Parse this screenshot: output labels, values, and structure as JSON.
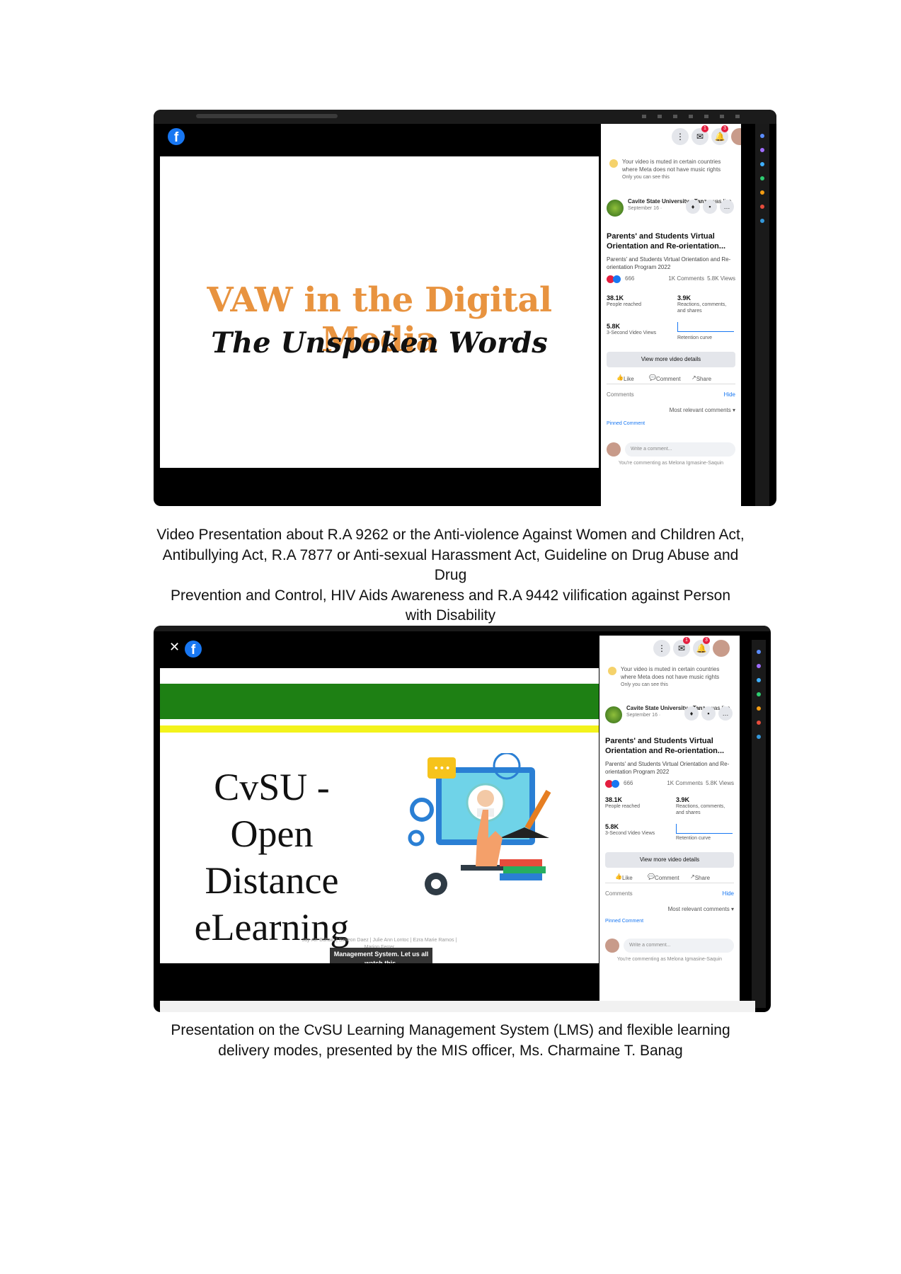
{
  "shot1": {
    "slide_title": "VAW in the Digital Media",
    "slide_subtitle": "The Unspoken Words"
  },
  "shot2": {
    "slide_lines": [
      "CvSU -",
      "Open Distance",
      "eLearning"
    ],
    "credits": "Jay-Arr Buhain | Simeon Daez | Julie Ann Lontoc | Ezra Marie Ramos | Marion Ferrer",
    "caption_overlay": "Management System. Let us all watch this."
  },
  "panel": {
    "muted_notice": "Your video is muted in certain countries where Meta does not have music rights",
    "only_you": "Only you can see this",
    "page_name": "Cavite State University - Tanza",
    "was_live": "was live.",
    "date": "September 16 ·",
    "video_title": "Parents' and Students Virtual Orientation and Re-orientation...",
    "video_desc": "Parents' and Students Virtual Orientation and Re-orientation Program 2022",
    "reactions_count": "666",
    "comments_count": "1K Comments",
    "views_count": "5.8K Views",
    "people_reached_num": "38.1K",
    "people_reached_label": "People reached",
    "reactions_num": "3.9K",
    "reactions_label": "Reactions, comments, and shares",
    "three_sec_num": "5.8K",
    "three_sec_label": "3-Second Video Views",
    "retention_label": "Retention curve",
    "more_details": "View more video details",
    "like": "Like",
    "comment": "Comment",
    "share": "Share",
    "comments_label": "Comments",
    "hide": "Hide",
    "most_relevant": "Most relevant comments ▾",
    "pinned": "Pinned Comment",
    "write_placeholder": "Write a comment...",
    "commenting_as": "You're commenting as Melona Igmasine-Saquin",
    "notif_badge_1": "1",
    "notif_badge_2": "3"
  },
  "captions": {
    "caption1_line1": "Video Presentation about R.A 9262 or the Anti-violence Against Women and Children Act,",
    "caption1_line2": "Antibullying Act, R.A 7877 or Anti-sexual Harassment Act, Guideline on Drug Abuse and",
    "caption1_line3": "Drug",
    "caption1_line4": "Prevention and Control, HIV Aids Awareness and R.A 9442 vilification against Person",
    "caption1_line5": "with Disability",
    "caption2_line1": "Presentation on the CvSU Learning Management System (LMS) and flexible learning",
    "caption2_line2": "delivery modes, presented by the MIS officer, Ms. Charmaine T. Banag"
  },
  "colors": {
    "slide_title_orange": "#e8933f",
    "cvsu_green": "#1e8014",
    "cvsu_yellow": "#f3f31b",
    "facebook_blue": "#1877f2"
  },
  "icons": [
    "facebook-logo-icon",
    "close-icon",
    "menu-grid-icon",
    "messenger-icon",
    "bell-icon",
    "avatar",
    "like-icon",
    "comment-icon",
    "share-icon",
    "pin-icon",
    "warning-icon"
  ]
}
